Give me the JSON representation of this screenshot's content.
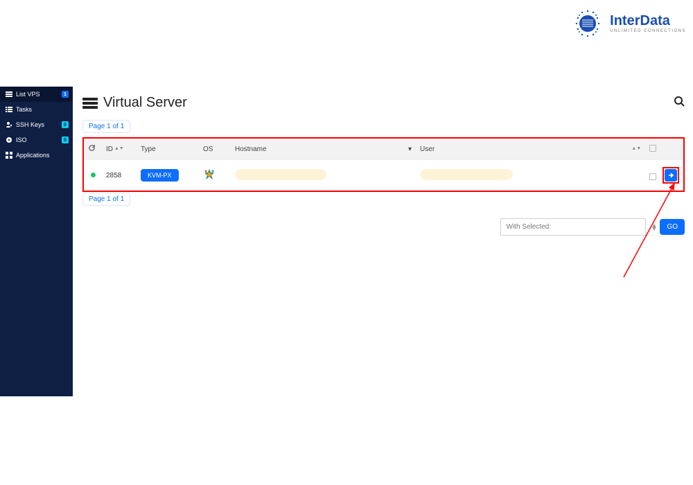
{
  "brand": {
    "name": "InterData",
    "tagline": "UNLIMITED CONNECTIONS"
  },
  "sidebar": {
    "items": [
      {
        "label": "List VPS",
        "icon": "list-icon",
        "badge": "1",
        "badge_style": "blue",
        "active": true
      },
      {
        "label": "Tasks",
        "icon": "tasks-icon"
      },
      {
        "label": "SSH Keys",
        "icon": "user-key-icon",
        "badge": "0",
        "badge_style": "cyan"
      },
      {
        "label": "ISO",
        "icon": "disc-icon",
        "badge": "0",
        "badge_style": "cyan"
      },
      {
        "label": "Applications",
        "icon": "apps-icon"
      }
    ]
  },
  "page": {
    "title": "Virtual Server",
    "pagination": "Page 1 of 1",
    "with_selected": "With Selected:",
    "go": "GO"
  },
  "table": {
    "headers": {
      "id": "ID",
      "type": "Type",
      "os": "OS",
      "hostname": "Hostname",
      "user": "User"
    },
    "rows": [
      {
        "status": "green",
        "id": "2858",
        "type": "KVM-PX",
        "os": "cloudlinux"
      }
    ]
  }
}
